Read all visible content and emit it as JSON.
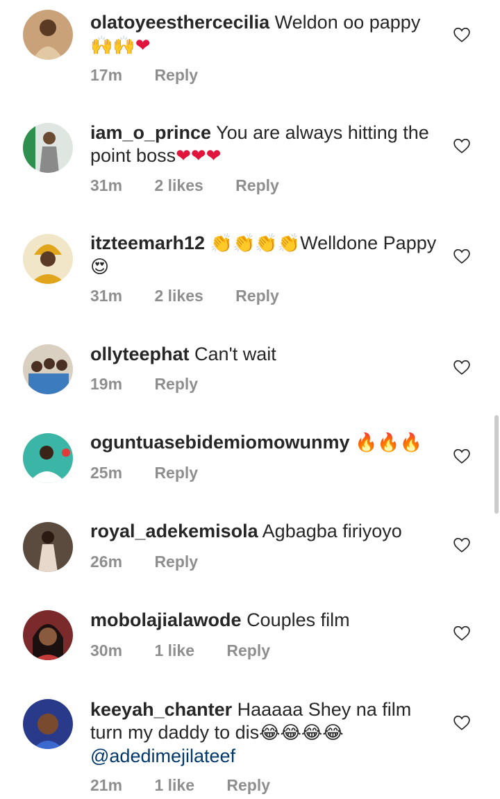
{
  "comments": [
    {
      "username": "olatoyeesthercecilia",
      "text": "Weldon oo pappy",
      "emoji": "🙌🙌❤",
      "time": "17m",
      "likes": "",
      "reply": "Reply"
    },
    {
      "username": "iam_o_prince",
      "text": "You are always hitting the point boss",
      "emoji": "❤❤❤",
      "time": "31m",
      "likes": "2 likes",
      "reply": "Reply"
    },
    {
      "username": "itzteemarh12",
      "emoji_pre": "👏👏👏👏",
      "text": "Welldone Pappy",
      "emoji": "😍",
      "time": "31m",
      "likes": "2 likes",
      "reply": "Reply"
    },
    {
      "username": "ollyteephat",
      "text": "Can't wait",
      "time": "19m",
      "likes": "",
      "reply": "Reply"
    },
    {
      "username": "oguntuasebidemiomowunmy",
      "emoji": "🔥🔥🔥",
      "time": "25m",
      "likes": "",
      "reply": "Reply"
    },
    {
      "username": "royal_adekemisola",
      "text": "Agbagba firiyoyo",
      "time": "26m",
      "likes": "",
      "reply": "Reply"
    },
    {
      "username": "mobolajialawode",
      "text": "Couples film",
      "time": "30m",
      "likes": "1 like",
      "reply": "Reply"
    },
    {
      "username": "keeyah_chanter",
      "text": "Haaaaa Shey na film turn my daddy to dis",
      "emoji": "😂😂😂😂",
      "mention": "@adedimejilateef",
      "time": "21m",
      "likes": "1 like",
      "reply": "Reply"
    }
  ],
  "icons": {
    "like": "heart-outline-icon"
  },
  "colors": {
    "username": "#262626",
    "meta": "#8e8e8e",
    "mention": "#00376b"
  }
}
